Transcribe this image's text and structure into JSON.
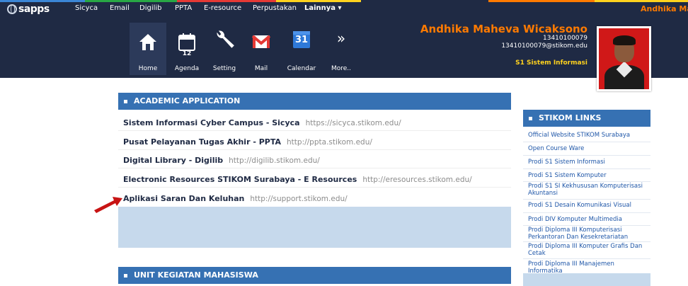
{
  "nav": {
    "logo": "sapps",
    "items": [
      "Sicyca",
      "Email",
      "Digilib",
      "PPTA",
      "E-resource",
      "Perpustakan",
      "Lainnya ▾"
    ],
    "user_name": "Andhika Mahe"
  },
  "toolbar": {
    "tools": [
      {
        "label": "Home",
        "icon": "home-icon"
      },
      {
        "label": "Agenda",
        "icon": "calendar-agenda-icon",
        "badge": "12"
      },
      {
        "label": "Setting",
        "icon": "wrench-icon"
      },
      {
        "label": "Mail",
        "icon": "gmail-icon"
      },
      {
        "label": "Calendar",
        "icon": "google-calendar-icon",
        "badge": "31"
      },
      {
        "label": "More..",
        "icon": "double-chevron-right-icon",
        "glyph": "»"
      }
    ]
  },
  "user": {
    "name": "Andhika Maheva Wicaksono",
    "nim": "13410100079",
    "email": "13410100079@stikom.edu",
    "program": "S1 Sistem Informasi"
  },
  "academic": {
    "title": "ACADEMIC APPLICATION",
    "items": [
      {
        "name": "Sistem Informasi Cyber Campus - Sicyca",
        "url": "https://sicyca.stikom.edu/"
      },
      {
        "name": "Pusat Pelayanan Tugas Akhir - PPTA",
        "url": "http://ppta.stikom.edu/"
      },
      {
        "name": "Digital Library - Digilib",
        "url": "http://digilib.stikom.edu/"
      },
      {
        "name": "Electronic Resources STIKOM Surabaya - E Resources",
        "url": "http://eresources.stikom.edu/"
      },
      {
        "name": "Aplikasi Saran Dan Keluhan",
        "url": "http://support.stikom.edu/"
      }
    ]
  },
  "ukm": {
    "title": "UNIT KEGIATAN MAHASISWA"
  },
  "links": {
    "title": "STIKOM LINKS",
    "items": [
      "Official Website STIKOM Surabaya",
      "Open Course Ware",
      "Prodi S1 Sistem Informasi",
      "Prodi S1 Sistem Komputer",
      "Prodi S1 SI Kekhususan Komputerisasi Akuntansi",
      "Prodi S1 Desain Komunikasi Visual",
      "Prodi DIV Komputer Multimedia",
      "Prodi Diploma III Komputerisasi Perkantoran Dan Kesekretariatan",
      "Prodi Diploma III Komputer Grafis Dan Cetak",
      "Prodi Diploma III Manajemen Informatika"
    ]
  },
  "colors": {
    "header_bg": "#1f2a44",
    "accent_orange": "#ff7a00",
    "accent_yellow": "#ffd21e",
    "panel_blue": "#3671b3",
    "link_blue": "#1e56a8",
    "arrow_red": "#c81414"
  }
}
